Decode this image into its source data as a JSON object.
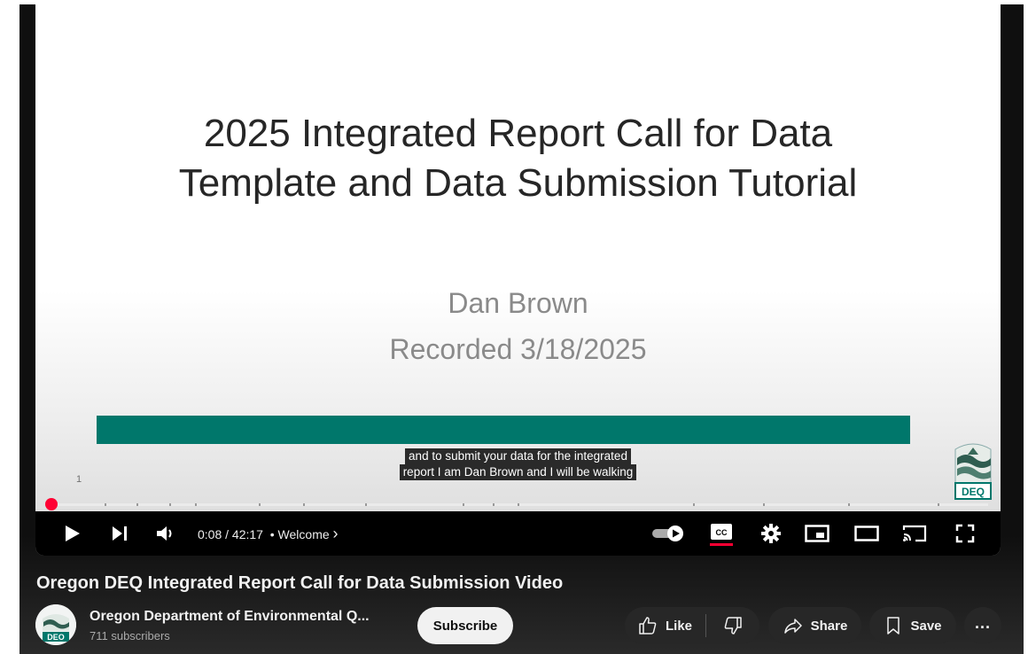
{
  "slide": {
    "title_line1": "2025 Integrated Report Call for Data",
    "title_line2": "Template and Data Submission Tutorial",
    "author": "Dan Brown",
    "recorded": "Recorded 3/18/2025",
    "slide_number": "1",
    "logo_text": "DEQ",
    "accent_color": "#00776b"
  },
  "captions": {
    "line1": "and to submit your data for the integrated",
    "line2": "report I am Dan Brown and I will be walking"
  },
  "player": {
    "current_time": "0:08",
    "duration": "42:17",
    "separator": " / ",
    "chapter_dot": "•",
    "chapter": "Welcome",
    "chapter_chevron": "›",
    "cc_label": "CC",
    "progress_fraction": 0.003,
    "icons": [
      "play-icon",
      "next-icon",
      "volume-icon",
      "autoplay-toggle-icon",
      "cc-icon",
      "settings-icon",
      "miniplayer-icon",
      "theater-icon",
      "cast-icon",
      "fullscreen-icon"
    ]
  },
  "video": {
    "title": "Oregon DEQ Integrated Report Call for Data Submission Video"
  },
  "channel": {
    "name": "Oregon Department of Environmental Q...",
    "subscribers": "711 subscribers",
    "avatar_text": "DEO",
    "subscribe_label": "Subscribe"
  },
  "actions": {
    "like_label": "Like",
    "share_label": "Share",
    "save_label": "Save",
    "more_label": "..."
  }
}
